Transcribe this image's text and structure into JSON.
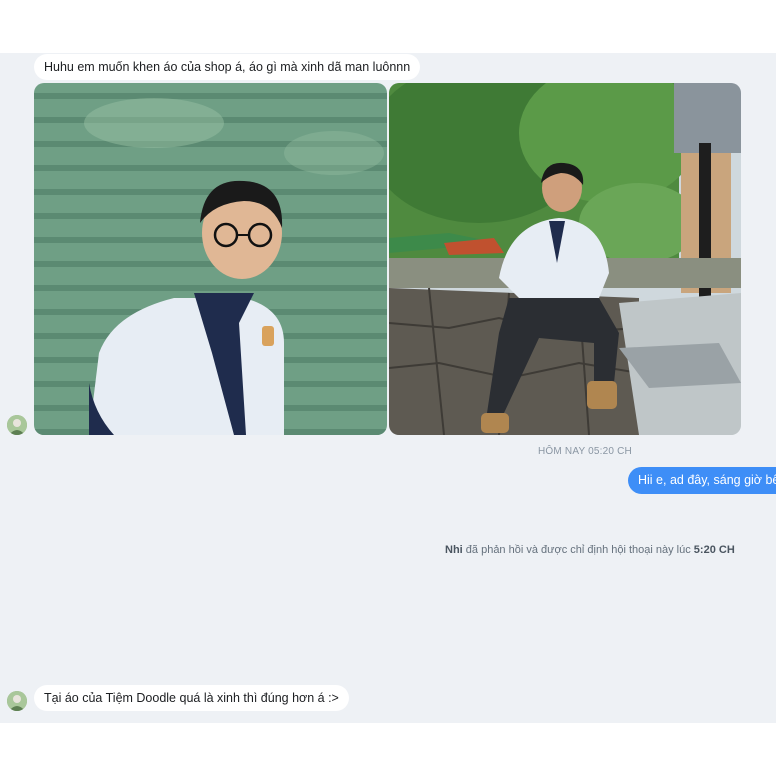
{
  "messages": {
    "first_incoming": "Huhu em muốn khen áo của shop á, áo gì mà xinh dã man luônnn",
    "outgoing": "Hii e, ad đây, sáng giờ bên a",
    "last_incoming": "Tại áo của Tiệm Doodle quá là xinh thì đúng hơn á :>"
  },
  "timestamp": "HÔM NAY 05:20 CH",
  "system_note": {
    "agent_name": "Nhi",
    "text": " đã phản hồi và được chỉ định hội thoại này lúc ",
    "time": "5:20 CH"
  },
  "photos": [
    {
      "name": "customer-photo-shutter-wall"
    },
    {
      "name": "customer-photo-sitting-wall"
    }
  ],
  "colors": {
    "chat_background": "#eef1f5",
    "outgoing_bubble": "#3e8ef7",
    "incoming_bubble": "#ffffff"
  }
}
